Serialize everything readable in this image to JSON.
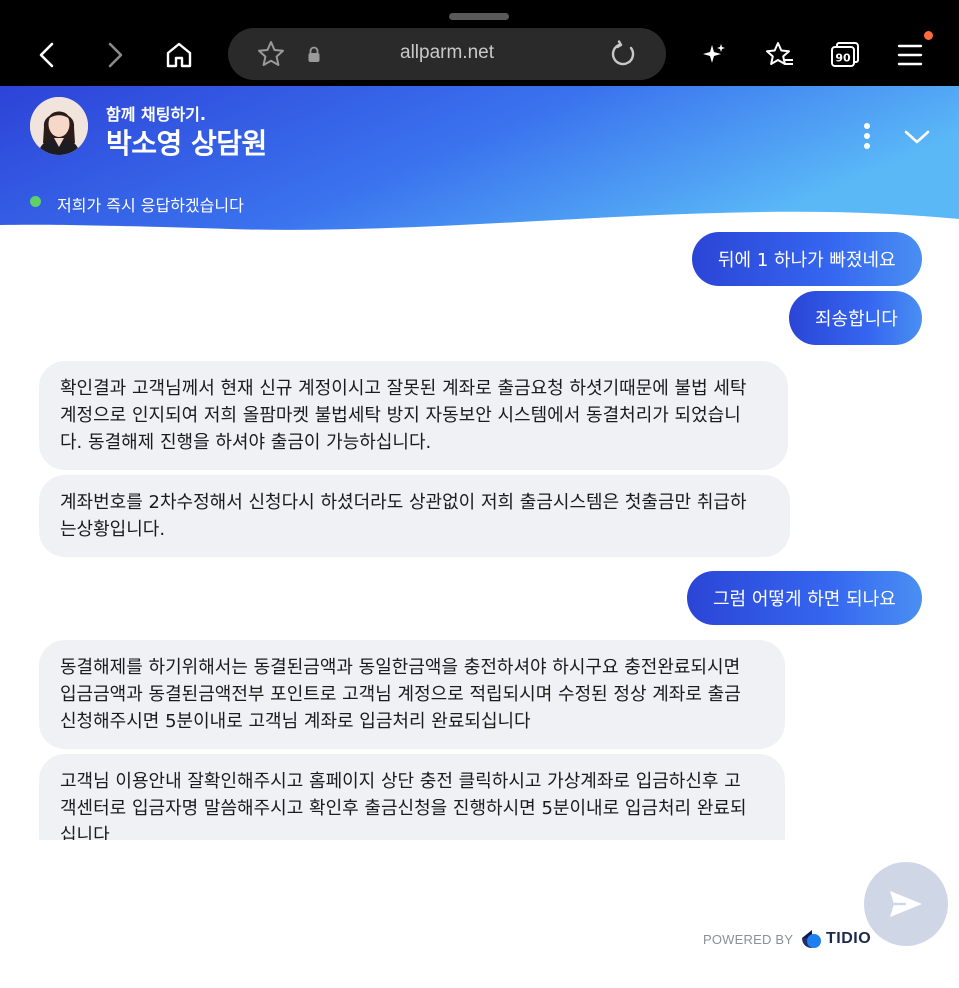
{
  "browser": {
    "url": "allparm.net",
    "icons": [
      "back-icon",
      "forward-icon",
      "home-icon",
      "star-icon",
      "lock-icon",
      "reload-icon",
      "sparkle-icon",
      "favorites-icon",
      "tabs-icon",
      "menu-icon"
    ],
    "tab_count": "90",
    "notification_color": "#ff6a3d"
  },
  "header": {
    "subtitle": "함께 채팅하기.",
    "title": "박소영 상담원",
    "status": "저희가 즉시 응답하겠습니다",
    "status_color": "#5fd068",
    "gradient": [
      "#2d43d8",
      "#5ab8f7"
    ]
  },
  "messages": [
    {
      "from": "user",
      "text": "뒤에 1 하나가 빠졌네요"
    },
    {
      "from": "user",
      "text": "죄송합니다"
    },
    {
      "from": "agent",
      "lines": [
        "확인결과 고객님께서 현재 신규 계정이시고 잘못된 계좌로 출금요청 하셧기때문에 불법 세탁",
        "계정으로 인지되여 저희 올팜마켓 불법세탁 방지 자동보안 시스템에서 동결처리가 되었습니",
        "다. 동결해제 진행을 하셔야 출금이 가능하십니다."
      ]
    },
    {
      "from": "agent",
      "lines": [
        "계좌번호를 2차수정해서 신청다시 하셨더라도 상관없이 저희 출금시스템은 첫출금만 취급하",
        "는상황입니다."
      ]
    },
    {
      "from": "user",
      "text": "그럼 어떻게 하면 되나요"
    },
    {
      "from": "agent",
      "lines": [
        "동결해제를 하기위해서는 동결된금액과 동일한금액을 충전하셔야 하시구요 충전완료되시면",
        "입금금액과 동결된금액전부 포인트로 고객님 계정으로 적립되시며 수정된 정상 계좌로 출금",
        "신청해주시면 5분이내로 고객님 계좌로 입금처리 완료되십니다"
      ]
    },
    {
      "from": "agent",
      "lines": [
        "고객님 이용안내 잘확인해주시고 홈페이지 상단 충전 클릭하시고 가상계좌로 입금하신후 고",
        "객센터로 입금자명 말씀해주시고 확인후 출금신청을 진행하시면 5분이내로 입금처리 완료되",
        "십니다"
      ]
    }
  ],
  "footer": {
    "powered_by": "POWERED BY",
    "brand": "TIDIO",
    "send_icon": "send-icon"
  }
}
